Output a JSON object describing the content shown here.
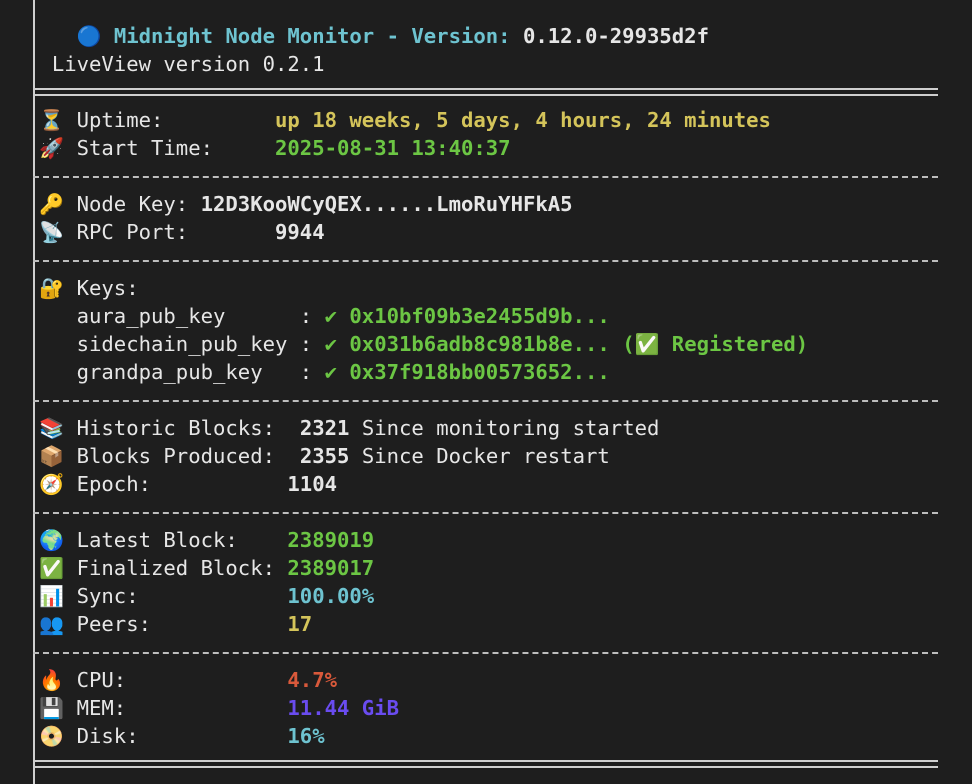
{
  "header": {
    "status_icon": "blue-circle-icon",
    "title_prefix": "Midnight Node Monitor - Version:",
    "version": "0.12.0-29935d2f",
    "liveview": "LiveView version 0.2.1"
  },
  "runtime": {
    "uptime_label": "Uptime:",
    "uptime_value": "up 18 weeks, 5 days, 4 hours, 24 minutes",
    "start_label": "Start Time:",
    "start_value": "2025-08-31 13:40:37"
  },
  "node": {
    "node_key_label": "Node Key:",
    "node_key_value": "12D3KooWCyQEX......LmoRuYHFkA5",
    "rpc_label": "RPC Port:",
    "rpc_value": "9944"
  },
  "keys": {
    "heading": "Keys:",
    "items": [
      {
        "name": "aura_pub_key     ",
        "check": "✔",
        "value": "0x10bf09b3e2455d9b...",
        "extra": ""
      },
      {
        "name": "sidechain_pub_key",
        "check": "✔",
        "value": "0x031b6adb8c981b8e...",
        "extra": "Registered)"
      },
      {
        "name": "grandpa_pub_key  ",
        "check": "✔",
        "value": "0x37f918bb00573652...",
        "extra": ""
      }
    ]
  },
  "blocks": {
    "historic_label": "Historic Blocks:",
    "historic_value": "2321",
    "historic_note": "Since monitoring started",
    "produced_label": "Blocks Produced:",
    "produced_value": "2355",
    "produced_note": "Since Docker restart",
    "epoch_label": "Epoch:",
    "epoch_value": "1104"
  },
  "chain": {
    "latest_label": "Latest Block:",
    "latest_value": "2389019",
    "finalized_label": "Finalized Block:",
    "finalized_value": "2389017",
    "sync_label": "Sync:",
    "sync_value": "100.00%",
    "peers_label": "Peers:",
    "peers_value": "17"
  },
  "resources": {
    "cpu_label": "CPU:",
    "cpu_value": "4.7%",
    "mem_label": "MEM:",
    "mem_value": "11.44 GiB",
    "disk_label": "Disk:",
    "disk_value": "16%"
  },
  "colors": {
    "background": "#1e1e1e",
    "title": "#6ec3d0",
    "yellow": "#d4c45a",
    "green": "#6cc644",
    "cyan": "#6ec3d0",
    "red": "#d9593b",
    "purple": "#6a4cf0"
  }
}
